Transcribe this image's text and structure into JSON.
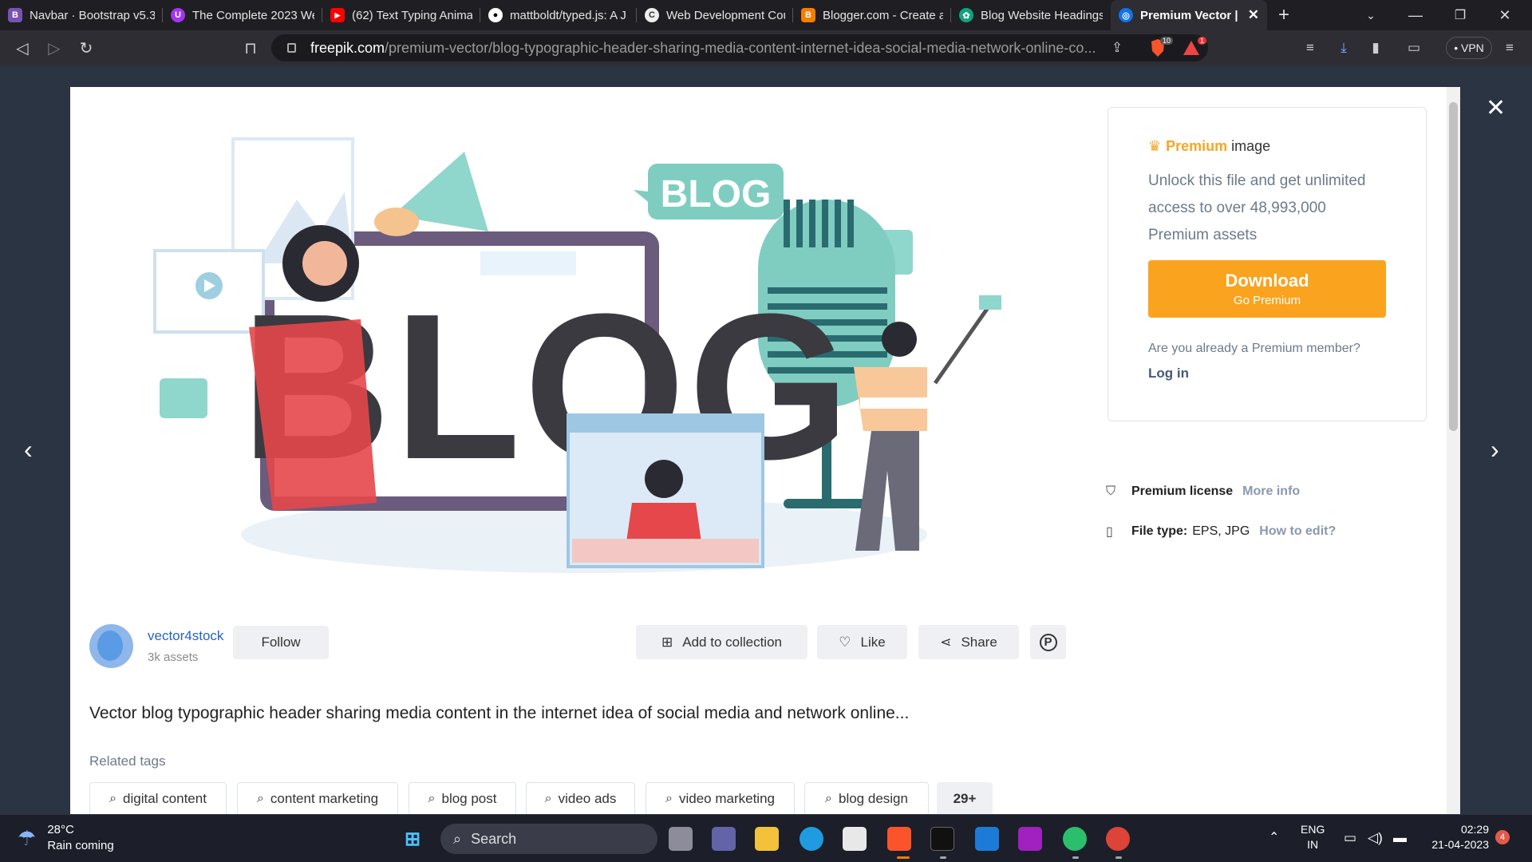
{
  "browser": {
    "tabs": [
      {
        "title": "Navbar · Bootstrap v5.3",
        "icon": "B",
        "color": "#7952b3"
      },
      {
        "title": "The Complete 2023 We",
        "icon": "U",
        "color": "#a435f0"
      },
      {
        "title": "(62) Text Typing Anima",
        "icon": "▶",
        "color": "#ff0000"
      },
      {
        "title": "mattboldt/typed.js: A J",
        "icon": "●",
        "color": "#333333"
      },
      {
        "title": "Web Development Cou",
        "icon": "C",
        "color": "#444444"
      },
      {
        "title": "Blogger.com - Create a",
        "icon": "B",
        "color": "#f57d00"
      },
      {
        "title": "Blog Website Headings",
        "icon": "✿",
        "color": "#10a37f"
      }
    ],
    "active_tab": {
      "title": "Premium Vector | V",
      "icon": "◎",
      "color": "#1273eb"
    },
    "new_tab": "+",
    "url_domain": "freepik.com",
    "url_path": "/premium-vector/blog-typographic-header-sharing-media-content-internet-idea-social-media-network-online-co...",
    "brave_badge": "10",
    "alert_badge": "1",
    "vpn": "• VPN"
  },
  "modal": {
    "premium": {
      "label_premium": "Premium",
      "label_image": "image",
      "description": "Unlock this file and get unlimited access to over 48,993,000 Premium assets",
      "download": "Download",
      "go_premium": "Go Premium",
      "already": "Are you already a Premium member?",
      "login": "Log in"
    },
    "license": {
      "label": "Premium license",
      "link": "More info"
    },
    "filetype": {
      "label": "File type:",
      "value": "EPS, JPG",
      "link": "How to edit?"
    },
    "author": {
      "name": "vector4stock",
      "assets": "3k assets",
      "follow": "Follow"
    },
    "actions": {
      "add": "Add to collection",
      "like": "Like",
      "share": "Share"
    },
    "caption": "Vector blog typographic header sharing media content in the internet idea of social media and network online...",
    "related_label": "Related tags",
    "tags": [
      "digital content",
      "content marketing",
      "blog post",
      "video ads",
      "video marketing",
      "blog design"
    ],
    "more_tags": "29+",
    "illustration": {
      "big_word": "BLOG",
      "bubble_word": "BLOG"
    }
  },
  "taskbar": {
    "temp": "28°C",
    "forecast": "Rain coming",
    "search": "Search",
    "lang1": "ENG",
    "lang2": "IN",
    "time": "02:29",
    "date": "21-04-2023",
    "notif": "4"
  }
}
